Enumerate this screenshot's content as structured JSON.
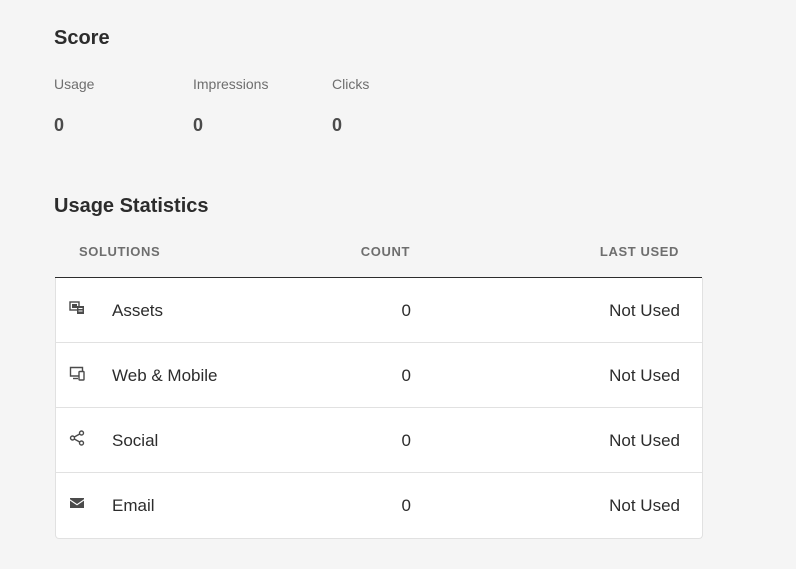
{
  "score": {
    "title": "Score",
    "metrics": [
      {
        "label": "Usage",
        "value": "0"
      },
      {
        "label": "Impressions",
        "value": "0"
      },
      {
        "label": "Clicks",
        "value": "0"
      }
    ]
  },
  "usage_statistics": {
    "title": "Usage Statistics",
    "columns": {
      "solutions": "SOLUTIONS",
      "count": "COUNT",
      "last_used": "LAST USED"
    },
    "rows": [
      {
        "icon": "assets-icon",
        "solution": "Assets",
        "count": "0",
        "last_used": "Not Used"
      },
      {
        "icon": "web-mobile-icon",
        "solution": "Web & Mobile",
        "count": "0",
        "last_used": "Not Used"
      },
      {
        "icon": "share-icon",
        "solution": "Social",
        "count": "0",
        "last_used": "Not Used"
      },
      {
        "icon": "email-icon",
        "solution": "Email",
        "count": "0",
        "last_used": "Not Used"
      }
    ]
  }
}
